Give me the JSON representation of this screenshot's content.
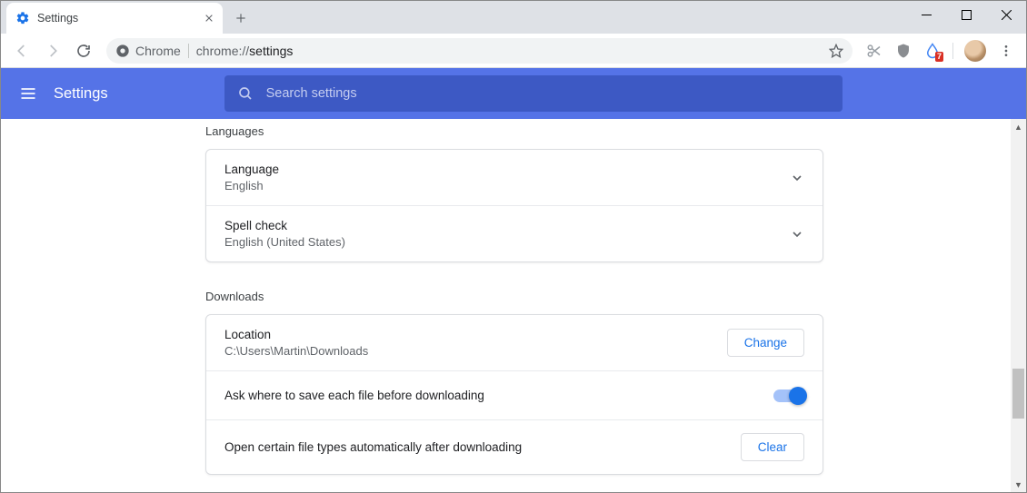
{
  "window": {
    "tab_title": "Settings",
    "url_prefix": "Chrome",
    "url_scheme": "chrome://",
    "url_path": "settings"
  },
  "header": {
    "title": "Settings",
    "search_placeholder": "Search settings"
  },
  "sections": {
    "languages": {
      "title": "Languages",
      "language_label": "Language",
      "language_value": "English",
      "spell_label": "Spell check",
      "spell_value": "English (United States)"
    },
    "downloads": {
      "title": "Downloads",
      "location_label": "Location",
      "location_value": "C:\\Users\\Martin\\Downloads",
      "change_btn": "Change",
      "ask_label": "Ask where to save each file before downloading",
      "auto_open_label": "Open certain file types automatically after downloading",
      "clear_btn": "Clear"
    }
  },
  "ext_badge": "7"
}
